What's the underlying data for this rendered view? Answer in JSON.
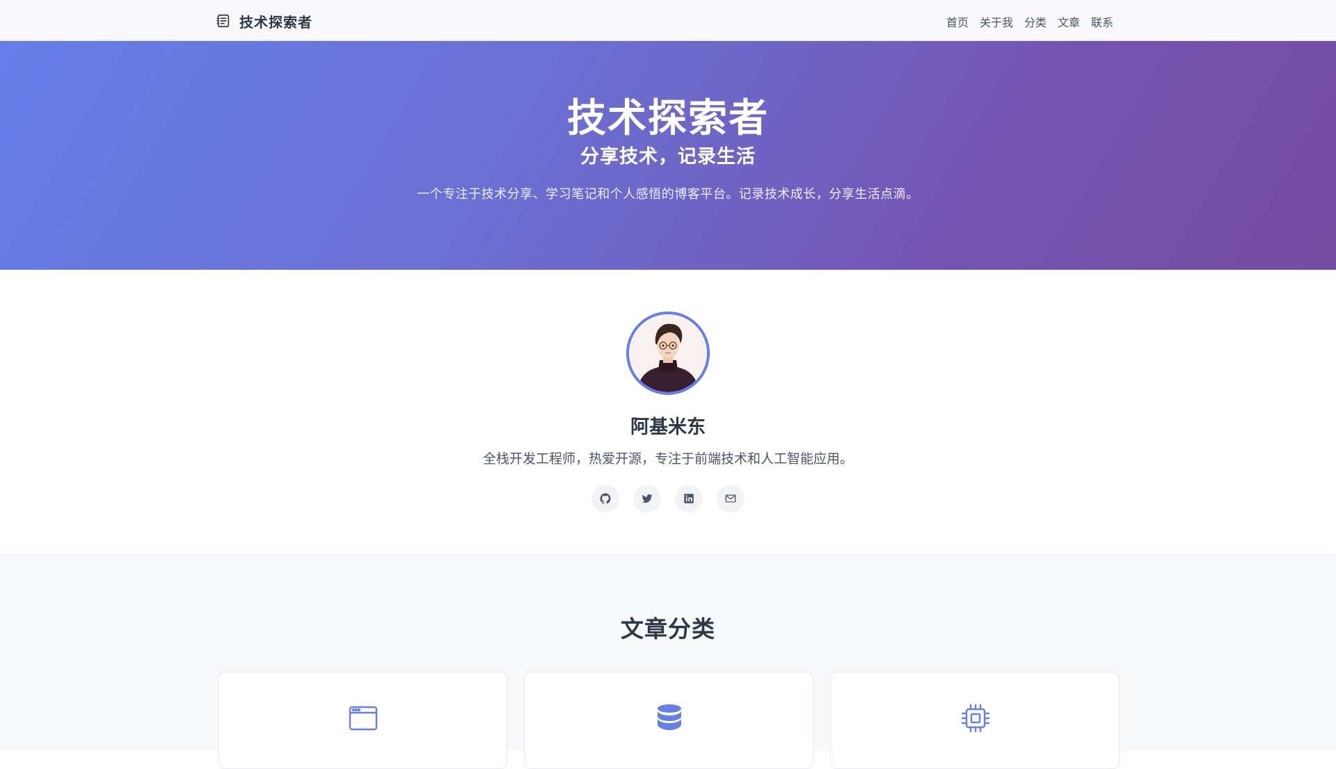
{
  "brand": {
    "name": "技术探索者",
    "icon": "notebook-icon"
  },
  "nav": {
    "items": [
      {
        "label": "首页"
      },
      {
        "label": "关于我"
      },
      {
        "label": "分类"
      },
      {
        "label": "文章"
      },
      {
        "label": "联系"
      }
    ]
  },
  "hero": {
    "title": "技术探索者",
    "subtitle": "分享技术，记录生活",
    "description": "一个专注于技术分享、学习笔记和个人感悟的博客平台。记录技术成长，分享生活点滴。"
  },
  "profile": {
    "name": "阿基米东",
    "bio": "全栈开发工程师，热爱开源，专注于前端技术和人工智能应用。",
    "socials": [
      {
        "icon": "github-icon"
      },
      {
        "icon": "twitter-icon"
      },
      {
        "icon": "linkedin-icon"
      },
      {
        "icon": "mail-icon"
      }
    ]
  },
  "categories": {
    "title": "文章分类",
    "cards": [
      {
        "icon": "browser-window-icon"
      },
      {
        "icon": "database-icon"
      },
      {
        "icon": "cpu-chip-icon"
      }
    ]
  },
  "colors": {
    "accent": "#667eea",
    "hero_gradient_start": "#667eea",
    "hero_gradient_end": "#764ba2",
    "text_dark": "#2d3748"
  }
}
